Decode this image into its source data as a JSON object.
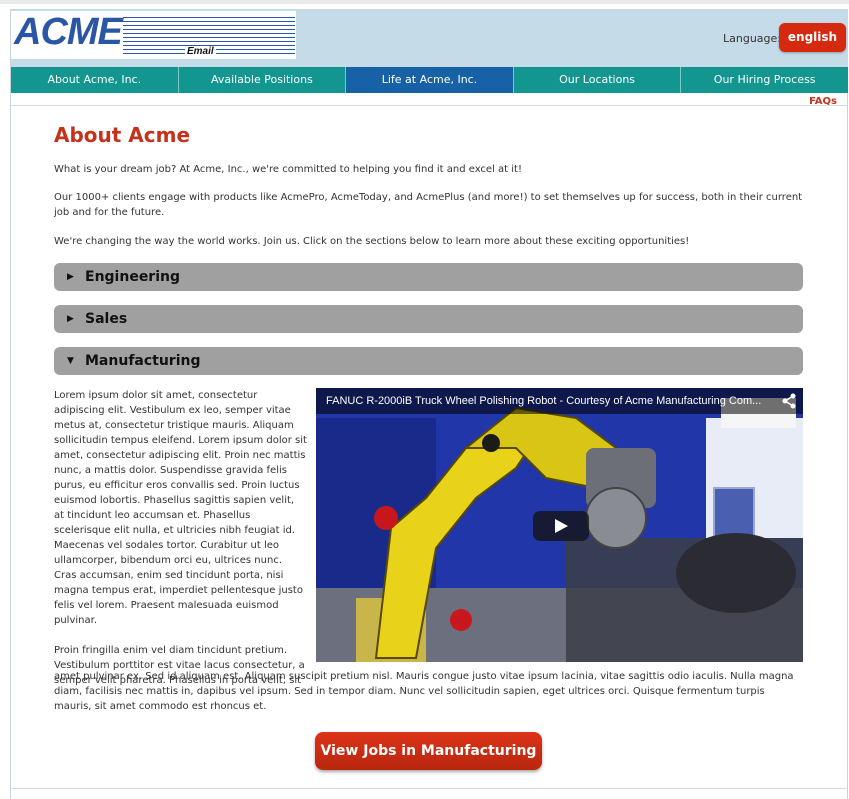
{
  "header": {
    "logo_text": "ACME",
    "logo_subtext": "Email",
    "language_label": "Language:",
    "language_button": "english"
  },
  "nav": {
    "items": [
      {
        "label": "About Acme, Inc."
      },
      {
        "label": "Available Positions"
      },
      {
        "label": "Life at Acme, Inc."
      },
      {
        "label": "Our Locations"
      },
      {
        "label": "Our Hiring Process"
      }
    ],
    "active_index": 2,
    "faqs": "FAQs"
  },
  "main": {
    "title": "About Acme",
    "intro": [
      "What is your dream job? At Acme, Inc., we're committed to helping you find it and excel at it!",
      "Our 1000+ clients engage with products like AcmePro, AcmeToday, and AcmePlus (and more!) to set themselves up for success, both in their current job and for the future.",
      "We're changing the way the world works. Join us. Click on the sections below to learn more about these exciting opportunities!"
    ],
    "accordion": [
      {
        "label": "Engineering",
        "expanded": false
      },
      {
        "label": "Sales",
        "expanded": false
      },
      {
        "label": "Manufacturing",
        "expanded": true
      }
    ],
    "section_text_1": "Lorem ipsum dolor sit amet, consectetur adipiscing elit. Vestibulum ex leo, semper vitae metus at, consectetur tristique mauris. Aliquam sollicitudin tempus eleifend. Lorem ipsum dolor sit amet, consectetur adipiscing elit. Proin nec mattis nunc, a mattis dolor. Suspendisse gravida felis purus, eu efficitur eros convallis sed. Proin luctus euismod lobortis. Phasellus sagittis sapien velit, at tincidunt leo accumsan et. Phasellus scelerisque elit nulla, et ultricies nibh feugiat id. Maecenas vel sodales tortor. Curabitur ut leo ullamcorper, bibendum orci eu, ultrices nunc. Cras accumsan, enim sed tincidunt porta, nisi magna tempus erat, imperdiet pellentesque justo felis vel lorem. Praesent malesuada euismod pulvinar.",
    "section_text_2": "Proin fringilla enim vel diam tincidunt pretium. Vestibulum porttitor est vitae lacus consectetur, a semper velit pharetra. Phasellus in porta velit, sit",
    "section_text_2_tail": "amet pulvinar ex. Sed id aliquam est. Aliquam suscipit pretium nisl. Mauris congue justo vitae ipsum lacinia, vitae sagittis odio iaculis. Nulla magna diam, facilisis nec mattis in, dapibus vel ipsum. Sed in tempor diam. Nunc vel sollicitudin sapien, eget ultrices orci. Quisque fermentum turpis mauris, sit amet commodo est rhoncus et.",
    "video": {
      "title": "FANUC R-2000iB Truck Wheel Polishing Robot - Courtesy of Acme Manufacturing Com..."
    },
    "cta_button": "View Jobs in Manufacturing"
  },
  "colors": {
    "brand_blue": "#2a56a6",
    "accent_red": "#c4321c",
    "nav_teal": "#12968f",
    "nav_active": "#1762a6",
    "header_bg": "#c5dbe8"
  }
}
